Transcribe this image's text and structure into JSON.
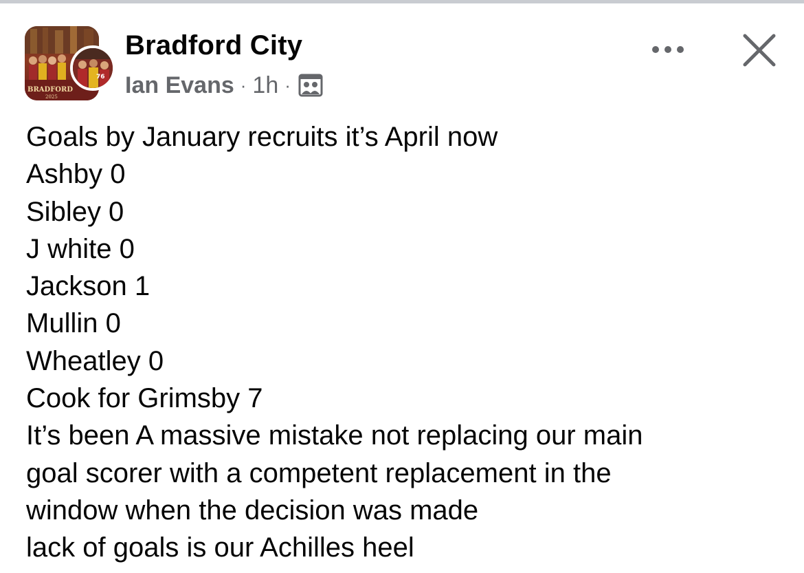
{
  "post": {
    "group_name": "Bradford City",
    "author": "Ian Evans",
    "separator": "·",
    "time": "1h",
    "audience_icon": "group-members-icon",
    "more_icon": "more-options-icon",
    "close_icon": "close-icon",
    "body_lines": [
      "Goals by January recruits it’s April now",
      "Ashby 0",
      "Sibley 0",
      "J white 0",
      "Jackson 1",
      "Mullin 0",
      "Wheatley 0",
      "Cook for Grimsby 7",
      "It’s been A massive mistake not replacing our main",
      "goal scorer with a competent replacement in the",
      "window when the decision was made",
      "lack of goals is our Achilles heel"
    ]
  },
  "colors": {
    "primary_text": "#050505",
    "secondary_text": "#65676b",
    "background": "#ffffff"
  }
}
